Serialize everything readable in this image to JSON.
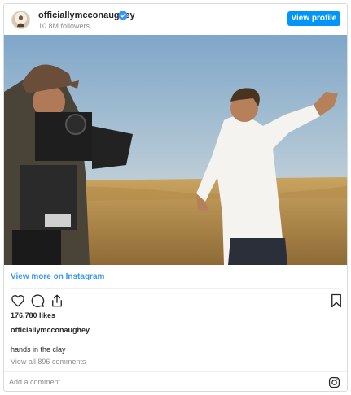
{
  "header": {
    "username": "officiallymcconaughey",
    "followers": "10.8M followers",
    "view_profile_label": "View profile"
  },
  "post": {
    "view_more_label": "View more on Instagram",
    "likes": "176,780 likes",
    "caption_username": "officiallymcconaughey",
    "caption_text": "hands in the clay",
    "view_comments": "View all 896 comments"
  },
  "comment": {
    "placeholder": "Add a comment..."
  },
  "icons": {
    "verified": "verified-badge-icon",
    "like": "heart-icon",
    "comment": "comment-bubble-icon",
    "share": "share-icon",
    "save": "bookmark-icon",
    "brand": "instagram-icon"
  },
  "colors": {
    "accent": "#0095f6",
    "link": "#3897f0",
    "muted": "#8e8e8e",
    "text": "#262626"
  }
}
